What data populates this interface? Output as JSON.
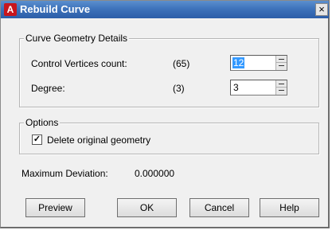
{
  "window": {
    "title": "Rebuild Curve",
    "icon_letter": "A",
    "close_glyph": "×"
  },
  "geometry": {
    "legend": "Curve Geometry Details",
    "cv_label": "Control Vertices count:",
    "cv_original": "(65)",
    "cv_value": "12",
    "degree_label": "Degree:",
    "degree_original": "(3)",
    "degree_value": "3"
  },
  "options": {
    "legend": "Options",
    "delete_label": "Delete original geometry",
    "delete_checked": true,
    "check_glyph": "✓"
  },
  "deviation": {
    "label": "Maximum Deviation:",
    "value": "0.000000"
  },
  "buttons": {
    "preview": "Preview",
    "ok": "OK",
    "cancel": "Cancel",
    "help": "Help"
  },
  "colors": {
    "titlebar": "#3e73bb",
    "selection": "#3399ff",
    "app_icon": "#c8161d"
  }
}
